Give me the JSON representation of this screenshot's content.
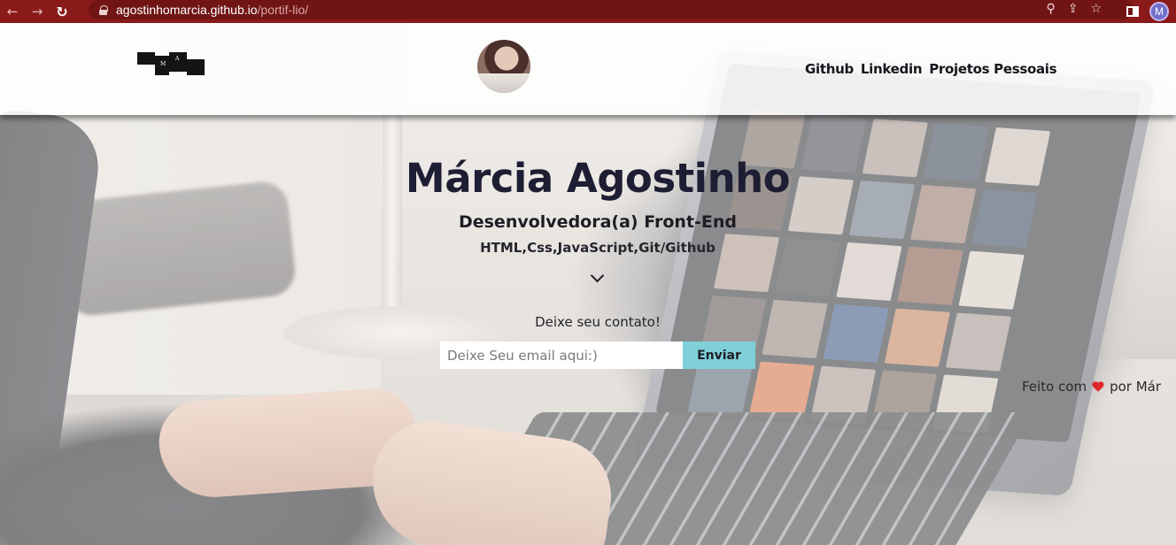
{
  "browser": {
    "url_domain": "agostinhomarcia.github.io",
    "url_path": "/portif-lio/",
    "profile_initial": "M",
    "icons": [
      "back-icon",
      "forward-icon",
      "reload-icon",
      "lock-icon",
      "zoom-icon",
      "share-icon",
      "star-icon",
      "sidepanel-icon"
    ]
  },
  "header": {
    "logo_letters": {
      "m": "M",
      "a": "A"
    },
    "nav": [
      "Github",
      "Linkedin",
      "Projetos Pessoais"
    ]
  },
  "hero": {
    "name": "Márcia Agostinho",
    "role": "Desenvolvedora(a) Front-End",
    "skills": "HTML,Css,JavaScript,Git/Github"
  },
  "contact": {
    "label": "Deixe seu contato!",
    "placeholder": "Deixe Seu email aqui:)",
    "button": "Enviar"
  },
  "footer": {
    "prefix": "Feito com",
    "suffix": "por Már"
  },
  "colors": {
    "chrome": "#8b1a1a",
    "button_bg": "#7fd0d9",
    "heart": "#e0262c",
    "title": "#1d1d33"
  }
}
